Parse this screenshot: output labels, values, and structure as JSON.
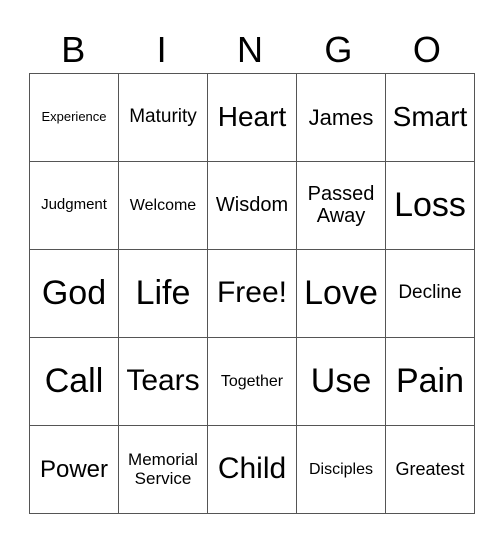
{
  "header": {
    "letters": [
      "B",
      "I",
      "N",
      "G",
      "O"
    ]
  },
  "card": {
    "rows": [
      [
        "Experience",
        "Maturity",
        "Heart",
        "James",
        "Smart"
      ],
      [
        "Judgment",
        "Welcome",
        "Wisdom",
        "Passed Away",
        "Loss"
      ],
      [
        "God",
        "Life",
        "Free!",
        "Love",
        "Decline"
      ],
      [
        "Call",
        "Tears",
        "Together",
        "Use",
        "Pain"
      ],
      [
        "Power",
        "Memorial Service",
        "Child",
        "Disciples",
        "Greatest"
      ]
    ]
  }
}
